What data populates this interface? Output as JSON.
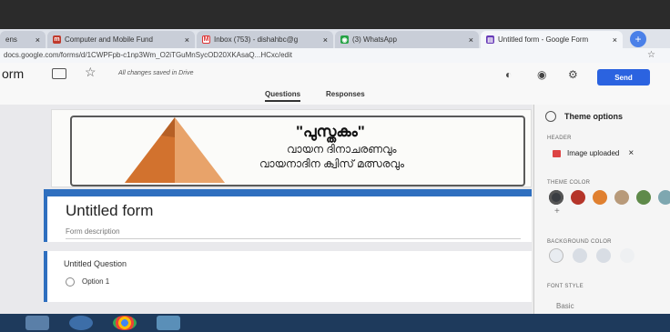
{
  "browser": {
    "tabs": [
      {
        "label": "ens",
        "favicon": "",
        "active": false
      },
      {
        "label": "Computer and Mobile Fund",
        "favicon": "m-icon",
        "active": false
      },
      {
        "label": "Inbox (753) - dishahbc@g",
        "favicon": "gmail-icon",
        "active": false
      },
      {
        "label": "(3) WhatsApp",
        "favicon": "whatsapp-icon",
        "active": false
      },
      {
        "label": "Untitled form - Google Form",
        "favicon": "forms-icon",
        "active": true
      }
    ],
    "url": "docs.google.com/forms/d/1CWPFpb-c1np3Wm_O2iTGuMnSycOD20XKAsaQ...HCxc/edit"
  },
  "toolbar": {
    "form_title_partial": "orm",
    "save_status": "All changes saved in Drive",
    "send_label": "Send"
  },
  "form_tabs": [
    "Questions",
    "Responses"
  ],
  "header_image": {
    "title": "\"പുസ്തകം\"",
    "line1": "വായന ദിനാചരണവും",
    "line2": "വായനാദിന ക്വിസ് മത്സരവും"
  },
  "form": {
    "title": "Untitled form",
    "description_placeholder": "Form description",
    "question": "Untitled Question",
    "option1": "Option 1"
  },
  "theme_panel": {
    "title": "Theme options",
    "header_label": "HEADER",
    "image_chip": "Image uploaded",
    "theme_color_label": "THEME COLOR",
    "theme_colors": [
      "#3a3d42",
      "#b5352a",
      "#e08030",
      "#b89a7a",
      "#5f8a4a",
      "#7ea7b0"
    ],
    "background_color_label": "BACKGROUND COLOR",
    "font_style_label": "FONT STYLE",
    "font_style_value": "Basic"
  },
  "colors": {
    "accent": "#2f6fbf",
    "send": "#2b63e0"
  }
}
